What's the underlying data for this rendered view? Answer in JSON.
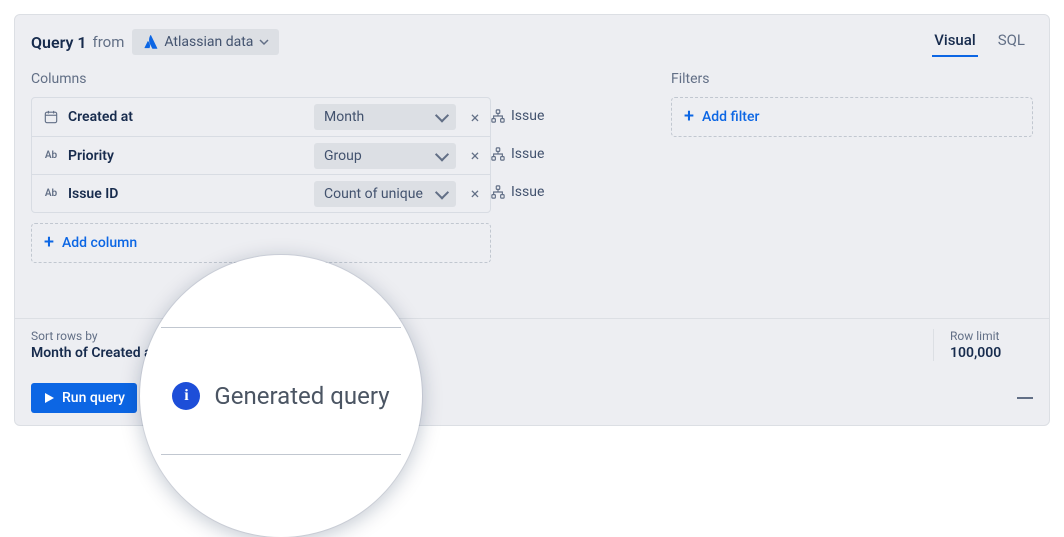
{
  "header": {
    "title": "Query 1",
    "from_label": "from",
    "source": "Atlassian data",
    "tabs": [
      {
        "id": "visual",
        "label": "Visual",
        "active": true
      },
      {
        "id": "sql",
        "label": "SQL",
        "active": false
      }
    ]
  },
  "columns": {
    "section_label": "Columns",
    "rows": [
      {
        "type": "date",
        "name": "Created at",
        "aggregation": "Month",
        "source": "Issue"
      },
      {
        "type": "text",
        "name": "Priority",
        "aggregation": "Group",
        "source": "Issue"
      },
      {
        "type": "text",
        "name": "Issue ID",
        "aggregation": "Count of unique",
        "source": "Issue"
      }
    ],
    "add_label": "Add column"
  },
  "filters": {
    "section_label": "Filters",
    "add_label": "Add filter"
  },
  "sort": {
    "label": "Sort rows by",
    "value": "Month of Created at"
  },
  "limit": {
    "label": "Row limit",
    "value": "100,000"
  },
  "footer": {
    "run_label": "Run query",
    "generated_label": "Generated query"
  }
}
